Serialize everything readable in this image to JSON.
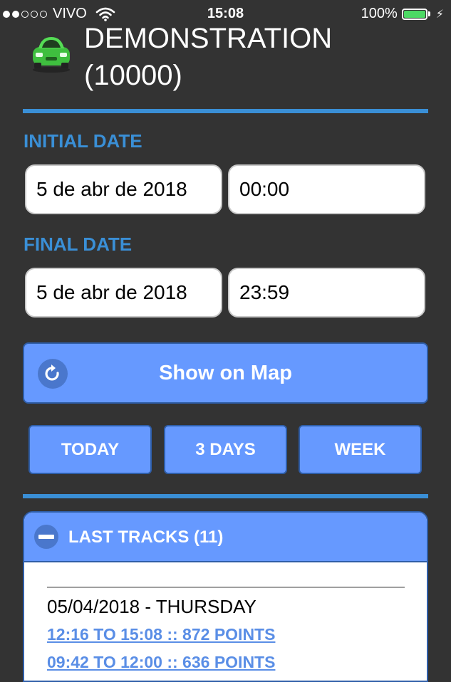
{
  "status_bar": {
    "carrier": "VIVO",
    "time": "15:08",
    "battery_percent": "100%",
    "battery_level": 1.0,
    "signal_bars_filled": 2,
    "signal_bars_total": 5,
    "icons": [
      "wifi-icon",
      "battery-icon",
      "charging-bolt-icon"
    ]
  },
  "header": {
    "title_line1": "DEMONSTRATION",
    "title_line2": "(10000)",
    "icon": "car-icon",
    "icon_color": "#44cc44"
  },
  "initial_date": {
    "label": "INITIAL DATE",
    "date": "5 de abr de 2018",
    "time": "00:00"
  },
  "final_date": {
    "label": "FINAL DATE",
    "date": "5 de abr de 2018",
    "time": "23:59"
  },
  "map_button": {
    "label": "Show on Map",
    "icon": "refresh-icon"
  },
  "range_buttons": {
    "today": "TODAY",
    "three_days": "3 DAYS",
    "week": "WEEK"
  },
  "last_tracks": {
    "title": "LAST TRACKS (11)",
    "icon": "minus-icon",
    "day": "05/04/2018 - THURSDAY",
    "tracks": [
      "12:16 TO 15:08 :: 872 POINTS",
      "09:42 TO 12:00 :: 636 POINTS"
    ]
  },
  "colors": {
    "background": "#333333",
    "accent": "#3a8fd6",
    "button": "#6699ff",
    "button_border": "#2f5ea8",
    "link": "#5a8ee6",
    "battery": "#4cd964"
  }
}
